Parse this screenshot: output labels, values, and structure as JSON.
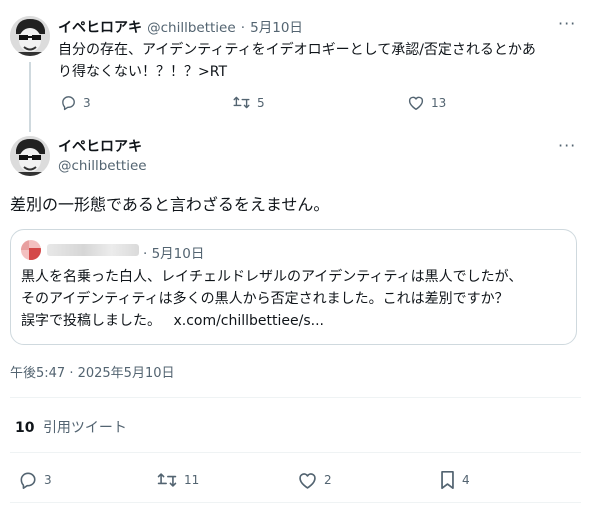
{
  "reply_tweet": {
    "display_name": "イペヒロアキ",
    "handle": "@chillbettiee",
    "date": "5月10日",
    "text_line1": "自分の存在、アイデンティティをイデオロギーとして承認/否定されるとかあ",
    "text_line2": "り得なくない！？！？>RT",
    "replies": "3",
    "retweets": "5",
    "likes": "13"
  },
  "main_tweet": {
    "display_name": "イペヒロアキ",
    "handle": "@chillbettiee",
    "text": "差別の一形態であると言わざるをえません。",
    "timestamp": "午後5:47 · 2025年5月10日",
    "quote_count": "10",
    "quote_label": "引用ツイート",
    "replies": "3",
    "retweets": "11",
    "likes": "2",
    "bookmarks": "4"
  },
  "quoted_tweet": {
    "date": "5月10日",
    "line1": "黒人を名乗った白人、レイチェルドレザルのアイデンティティは黒人でしたが、",
    "line2": "そのアイデンティティは多くの黒人から否定されました。これは差別ですか？",
    "line3_text": "誤字で投稿しました。",
    "line3_link": "x.com/chillbettiee/s..."
  },
  "colors": {
    "text": "#0f1419",
    "muted": "#536471",
    "border": "#cfd9de",
    "divider": "#eff3f4",
    "background": "#ffffff"
  },
  "icons": {
    "more": "more-icon",
    "reply": "reply-icon",
    "retweet": "retweet-icon",
    "like": "heart-icon",
    "bookmark": "bookmark-icon"
  }
}
